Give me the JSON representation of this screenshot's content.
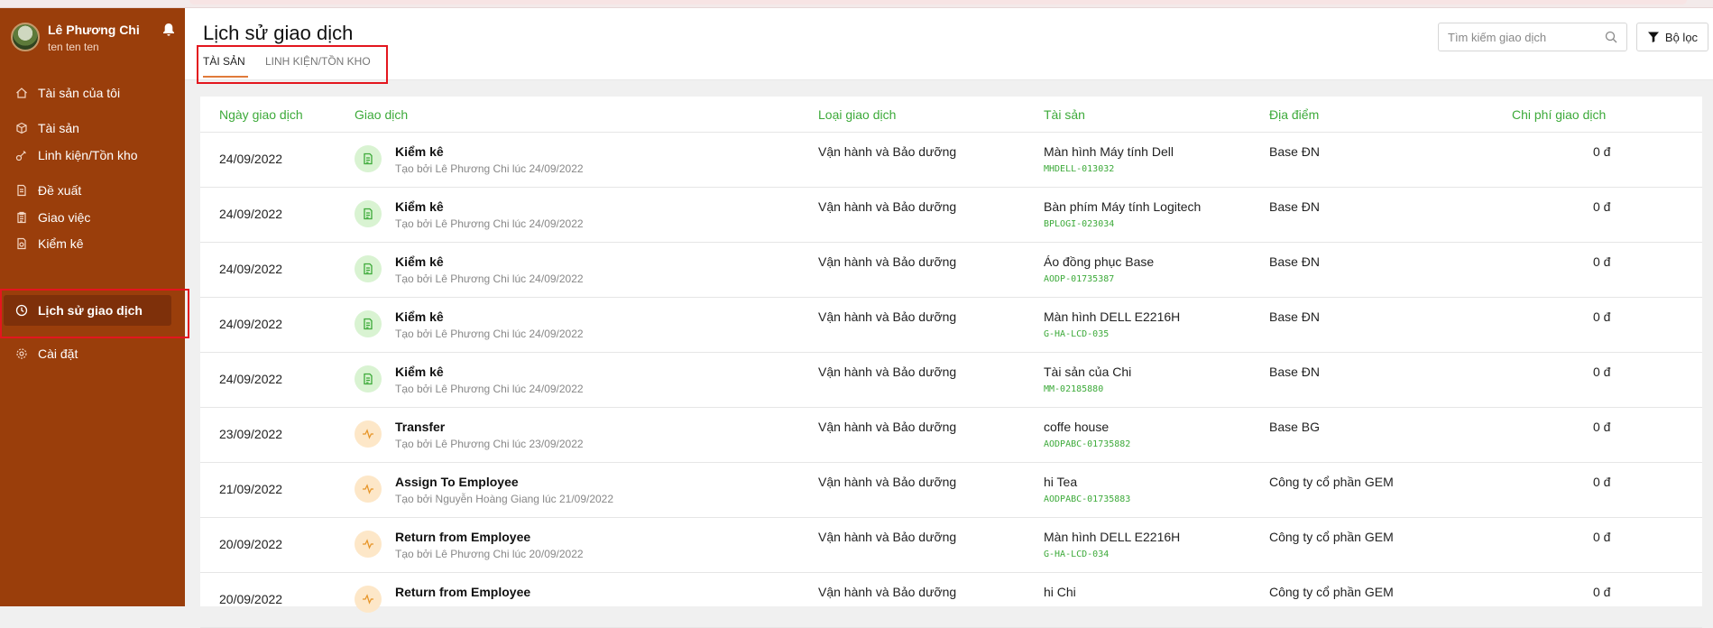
{
  "sidebar": {
    "profile": {
      "name": "Lê Phương Chi",
      "subtitle": "ten ten ten"
    },
    "items": [
      {
        "label": "Tài sản của tôi",
        "icon": "home-icon"
      },
      {
        "label": "Tài sản",
        "icon": "box-icon"
      },
      {
        "label": "Linh kiện/Tồn kho",
        "icon": "parts-icon"
      },
      {
        "label": "Đề xuất",
        "icon": "document-icon"
      },
      {
        "label": "Giao việc",
        "icon": "clipboard-icon"
      },
      {
        "label": "Kiểm kê",
        "icon": "audit-icon"
      },
      {
        "label": "Lịch sử giao dịch",
        "icon": "history-icon",
        "active": true
      },
      {
        "label": "Cài đặt",
        "icon": "gear-icon"
      }
    ]
  },
  "header": {
    "title": "Lịch sử giao dịch",
    "tabs": [
      {
        "label": "TÀI SẢN",
        "active": true
      },
      {
        "label": "LINH KIỆN/TỒN KHO",
        "active": false
      }
    ],
    "search_placeholder": "Tìm kiếm giao dịch",
    "filter_label": "Bộ lọc"
  },
  "table": {
    "columns": [
      "Ngày giao dịch",
      "Giao dịch",
      "Loại giao dịch",
      "Tài sản",
      "Địa điểm",
      "Chi phí giao dịch"
    ],
    "rows": [
      {
        "date": "24/09/2022",
        "icon": "audit-icon",
        "name": "Kiểm kê",
        "sub": "Tạo bởi Lê Phương Chi lúc 24/09/2022",
        "type": "Vận hành và Bảo dưỡng",
        "asset": "Màn hình Máy tính Dell",
        "code": "MHDELL-013032",
        "location": "Base ĐN",
        "cost": "0 đ"
      },
      {
        "date": "24/09/2022",
        "icon": "audit-icon",
        "name": "Kiểm kê",
        "sub": "Tạo bởi Lê Phương Chi lúc 24/09/2022",
        "type": "Vận hành và Bảo dưỡng",
        "asset": "Bàn phím Máy tính Logitech",
        "code": "BPLOGI-023034",
        "location": "Base ĐN",
        "cost": "0 đ"
      },
      {
        "date": "24/09/2022",
        "icon": "audit-icon",
        "name": "Kiểm kê",
        "sub": "Tạo bởi Lê Phương Chi lúc 24/09/2022",
        "type": "Vận hành và Bảo dưỡng",
        "asset": "Áo đồng phục Base",
        "code": "AODP-01735387",
        "location": "Base ĐN",
        "cost": "0 đ"
      },
      {
        "date": "24/09/2022",
        "icon": "audit-icon",
        "name": "Kiểm kê",
        "sub": "Tạo bởi Lê Phương Chi lúc 24/09/2022",
        "type": "Vận hành và Bảo dưỡng",
        "asset": "Màn hình DELL E2216H",
        "code": "G-HA-LCD-035",
        "location": "Base ĐN",
        "cost": "0 đ"
      },
      {
        "date": "24/09/2022",
        "icon": "audit-icon",
        "name": "Kiểm kê",
        "sub": "Tạo bởi Lê Phương Chi lúc 24/09/2022",
        "type": "Vận hành và Bảo dưỡng",
        "asset": "Tài sản của Chi",
        "code": "MM-02185880",
        "location": "Base ĐN",
        "cost": "0 đ"
      },
      {
        "date": "23/09/2022",
        "icon": "activity-icon",
        "name": "Transfer",
        "sub": "Tạo bởi Lê Phương Chi lúc 23/09/2022",
        "type": "Vận hành và Bảo dưỡng",
        "asset": "coffe house",
        "code": "AODPABC-01735882",
        "location": "Base BG",
        "cost": "0 đ"
      },
      {
        "date": "21/09/2022",
        "icon": "activity-icon",
        "name": "Assign To Employee",
        "sub": "Tạo bởi Nguyễn Hoàng Giang lúc 21/09/2022",
        "type": "Vận hành và Bảo dưỡng",
        "asset": "hi Tea",
        "code": "AODPABC-01735883",
        "location": "Công ty cổ phần GEM",
        "cost": "0 đ"
      },
      {
        "date": "20/09/2022",
        "icon": "activity-icon",
        "name": "Return from Employee",
        "sub": "Tạo bởi Lê Phương Chi lúc 20/09/2022",
        "type": "Vận hành và Bảo dưỡng",
        "asset": "Màn hình DELL E2216H",
        "code": "G-HA-LCD-034",
        "location": "Công ty cổ phần GEM",
        "cost": "0 đ"
      },
      {
        "date": "20/09/2022",
        "icon": "activity-icon",
        "name": "Return from Employee",
        "sub": "",
        "type": "Vận hành và Bảo dưỡng",
        "asset": "hi Chi",
        "code": "",
        "location": "Công ty cổ phần GEM",
        "cost": "0 đ"
      }
    ]
  },
  "colors": {
    "sidebar": "#9a3e0b",
    "accent_green": "#3daa3a",
    "highlight_box": "#e3161e"
  }
}
